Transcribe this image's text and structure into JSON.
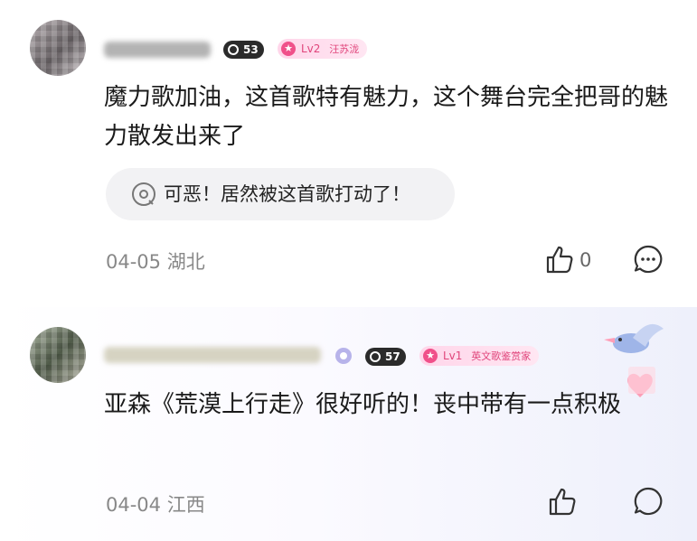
{
  "comments": [
    {
      "level_badge": "53",
      "fan_badge": {
        "level": "Lv2",
        "tag": "汪苏泷"
      },
      "text": "魔力歌加油，这首歌特有魅力，这个舞台完全把哥的魅力散发出来了",
      "reply_quote": "可恶！居然被这首歌打动了！",
      "date": "04-05",
      "location": "湖北",
      "likes": "0"
    },
    {
      "level_badge": "57",
      "fan_badge": {
        "level": "Lv1",
        "tag": "英文歌鉴赏家"
      },
      "text": "亚森《荒漠上行走》很好听的！丧中带有一点积极",
      "date": "04-04",
      "location": "江西"
    }
  ],
  "colors": {
    "fan_badge_text": "#e0457b",
    "meta_text": "#888888",
    "reply_bg": "#f2f2f4"
  }
}
